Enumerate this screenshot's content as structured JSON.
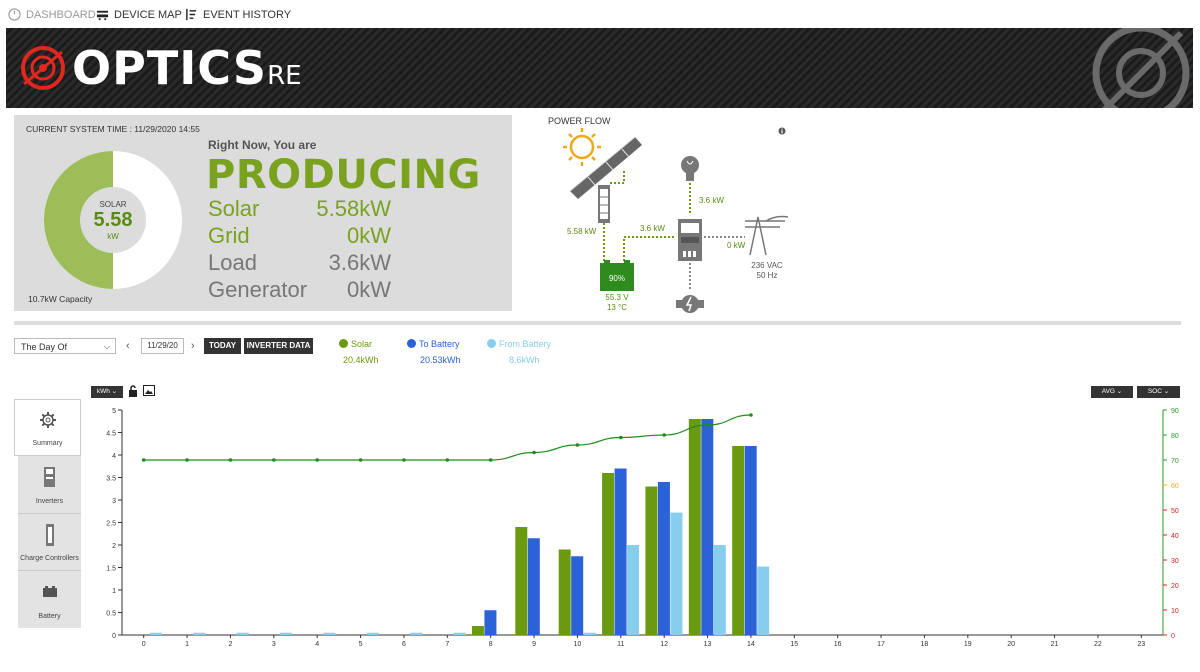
{
  "nav": {
    "dashboard": "DASHBOARD",
    "device_map": "DEVICE MAP",
    "event_history": "EVENT HISTORY"
  },
  "brand": {
    "name": "OPTICS",
    "suffix": "RE"
  },
  "summary": {
    "system_time": "CURRENT SYSTEM TIME : 11/29/2020 14:55",
    "donut_source": "SOLAR",
    "donut_value": "5.58",
    "donut_unit": "kW",
    "solar_fraction": 0.5,
    "capacity": "10.7kW Capacity",
    "right_now": "Right Now, You are",
    "status": "PRODUCING",
    "rows": [
      {
        "label": "Solar",
        "value": "5.58kW"
      },
      {
        "label": "Grid",
        "value": "0kW"
      },
      {
        "label": "Load",
        "value": "3.6kW"
      },
      {
        "label": "Generator",
        "value": "0kW"
      }
    ]
  },
  "power_flow": {
    "title": "POWER FLOW",
    "solar_kw": "5.58 kW",
    "inverter_kw": "3.6 kW",
    "load_kw": "3.6 kW",
    "grid_kw": "0 kW",
    "battery_soc": "90%",
    "battery_voltage": "55.3 V",
    "battery_temp": "13 °C",
    "grid_voltage": "236 VAC",
    "grid_freq": "50 Hz"
  },
  "controls": {
    "range_select": "The Day Of",
    "date": "11/29/20",
    "today": "TODAY",
    "inverter_data": "INVERTER DATA",
    "prev": "‹",
    "next": "›",
    "unit_select": "kWh",
    "avg_select": "AVG",
    "soc_select": "SOC"
  },
  "legend": [
    {
      "name": "Solar",
      "total": "20.4kWh",
      "color": "#6a9a10"
    },
    {
      "name": "To Battery",
      "total": "20.53kWh",
      "color": "#2b62d8"
    },
    {
      "name": "From Battery",
      "total": "8.6kWh",
      "color": "#86cdee"
    }
  ],
  "side_tabs": [
    {
      "label": "Summary"
    },
    {
      "label": "Inverters"
    },
    {
      "label": "Charge Controllers"
    },
    {
      "label": "Battery"
    }
  ],
  "chart_data": {
    "type": "bar",
    "categories": [
      "0",
      "1",
      "2",
      "3",
      "4",
      "5",
      "6",
      "7",
      "8",
      "9",
      "10",
      "11",
      "12",
      "13",
      "14",
      "15",
      "16",
      "17",
      "18",
      "19",
      "20",
      "21",
      "22",
      "23"
    ],
    "series": [
      {
        "name": "Solar",
        "color": "#6a9a10",
        "values": [
          0,
          0,
          0,
          0,
          0,
          0,
          0,
          0,
          0.2,
          2.4,
          1.9,
          3.6,
          3.3,
          4.8,
          4.2,
          0,
          0,
          0,
          0,
          0,
          0,
          0,
          0,
          0
        ]
      },
      {
        "name": "To Battery",
        "color": "#2b62d8",
        "values": [
          0,
          0,
          0,
          0,
          0,
          0,
          0,
          0,
          0.55,
          2.15,
          1.75,
          3.7,
          3.4,
          4.8,
          4.2,
          0,
          0,
          0,
          0,
          0,
          0,
          0,
          0,
          0
        ]
      },
      {
        "name": "From Battery",
        "color": "#86cdee",
        "values": [
          0.05,
          0.05,
          0.05,
          0.05,
          0.05,
          0.05,
          0.05,
          0.05,
          0,
          0,
          0.05,
          2.0,
          2.72,
          2.0,
          1.52,
          0,
          0,
          0,
          0,
          0,
          0,
          0,
          0,
          0
        ]
      }
    ],
    "soc_line": {
      "name": "SOC",
      "x": [
        0,
        1,
        2,
        3,
        4,
        5,
        6,
        7,
        8,
        9,
        10,
        11,
        12,
        13,
        14
      ],
      "values": [
        70,
        70,
        70,
        70,
        70,
        70,
        70,
        70,
        70,
        73,
        76,
        79,
        80,
        84,
        88
      ]
    },
    "ylim": [
      0,
      5
    ],
    "yticks": [
      "0",
      "0.5",
      "1",
      "1.5",
      "2",
      "2.5",
      "3",
      "3.5",
      "4",
      "4.5",
      "5"
    ],
    "y2lim": [
      0,
      90
    ],
    "y2ticks": [
      "0",
      "10",
      "20",
      "30",
      "40",
      "50",
      "60",
      "70",
      "80",
      "90"
    ]
  }
}
